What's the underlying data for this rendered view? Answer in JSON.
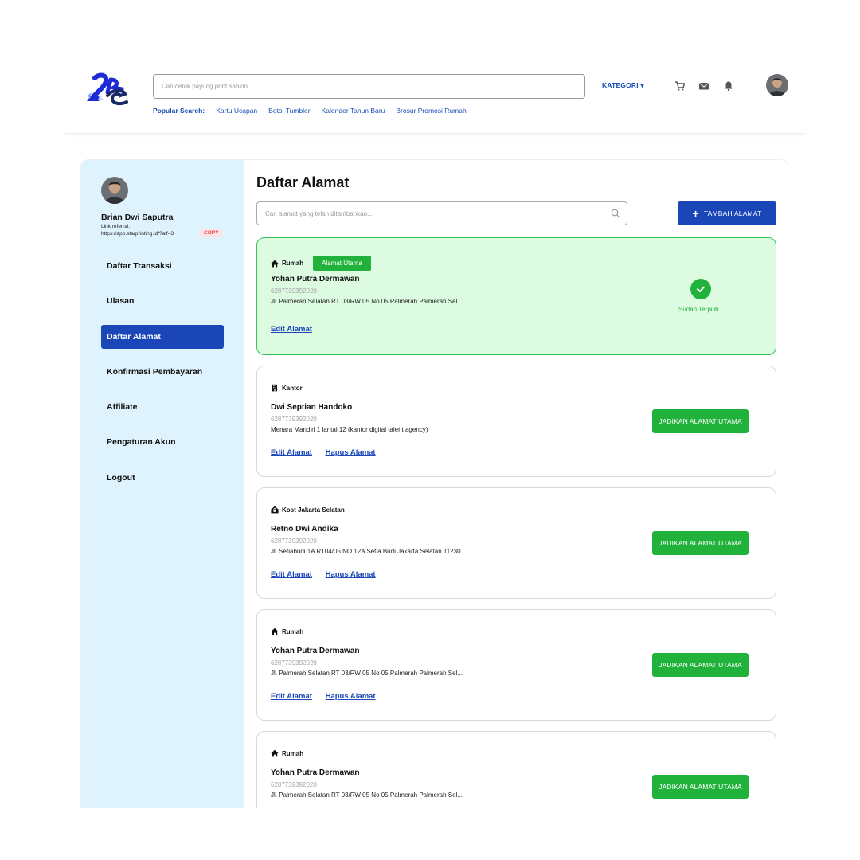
{
  "header": {
    "search_placeholder": "Cari cetak payung print sablon...",
    "popular_label": "Popular Search:",
    "popular_links": [
      "Kartu Ucapan",
      "Botol Tumbler",
      "Kalender Tahun Baru",
      "Brosur Promosi Rumah"
    ],
    "kategori_label": "KATEGORI ▾",
    "icons": [
      "cart-icon",
      "mail-icon",
      "bell-icon"
    ]
  },
  "sidebar": {
    "user_name": "Brian Dwi Saputra",
    "referral_label": "Link referral:",
    "referral_link": "https://app.starprinting.id/?aff=3",
    "copy_label": "COPY",
    "items": [
      {
        "label": "Daftar Transaksi"
      },
      {
        "label": "Ulasan"
      },
      {
        "label": "Daftar Alamat"
      },
      {
        "label": "Konfirmasi Pembayaran"
      },
      {
        "label": "Affiliate"
      },
      {
        "label": "Pengaturan Akun"
      },
      {
        "label": "Logout"
      }
    ]
  },
  "main": {
    "title": "Daftar Alamat",
    "search_placeholder": "Cari alamat yang telah ditambahkan...",
    "add_button_label": "TAMBAH ALAMAT",
    "primary_badge": "Alamat Utama",
    "selected_label": "Sudah Terpilih",
    "edit_label": "Edit Alamat",
    "delete_label": "Hapus Alamat",
    "set_primary_label": "JADIKAN ALAMAT UTAMA",
    "separator": "·",
    "addresses": [
      {
        "type": "Rumah",
        "icon": "home-icon",
        "name": "Yohan Putra Dermawan",
        "phone": "6287739392020",
        "address": "Jl. Palmerah Selatan RT 03/RW 05 No 05 Palmerah Palmerah Sel...",
        "primary": true
      },
      {
        "type": "Kantor",
        "icon": "building-icon",
        "name": "Dwi Septian Handoko",
        "phone": "6287739392020",
        "address": "Menara Mandiri 1 lantai 12 (kantor digital talent agency)",
        "primary": false
      },
      {
        "type": "Kost Jakarta Selatan",
        "icon": "house-lock-icon",
        "name": "Retno Dwi Andika",
        "phone": "6287739392020",
        "address": "Jl. Setiabudi 1A RT04/05 NO 12A Setia Budi Jakarta Selatan 11230",
        "primary": false
      },
      {
        "type": "Rumah",
        "icon": "home-icon",
        "name": "Yohan Putra Dermawan",
        "phone": "6287739392020",
        "address": "Jl. Palmerah Selatan RT 03/RW 05 No 05 Palmerah Palmerah Sel...",
        "primary": false
      },
      {
        "type": "Rumah",
        "icon": "home-icon",
        "name": "Yohan Putra Dermawan",
        "phone": "6287739392020",
        "address": "Jl. Palmerah Selatan RT 03/RW 05 No 05 Palmerah Palmerah Sel...",
        "primary": false
      }
    ]
  },
  "colors": {
    "brand_blue": "#1a46b8",
    "success_green": "#21b23b",
    "sidebar_bg": "#dff3fe",
    "primary_card_bg": "#dcfbe0"
  }
}
